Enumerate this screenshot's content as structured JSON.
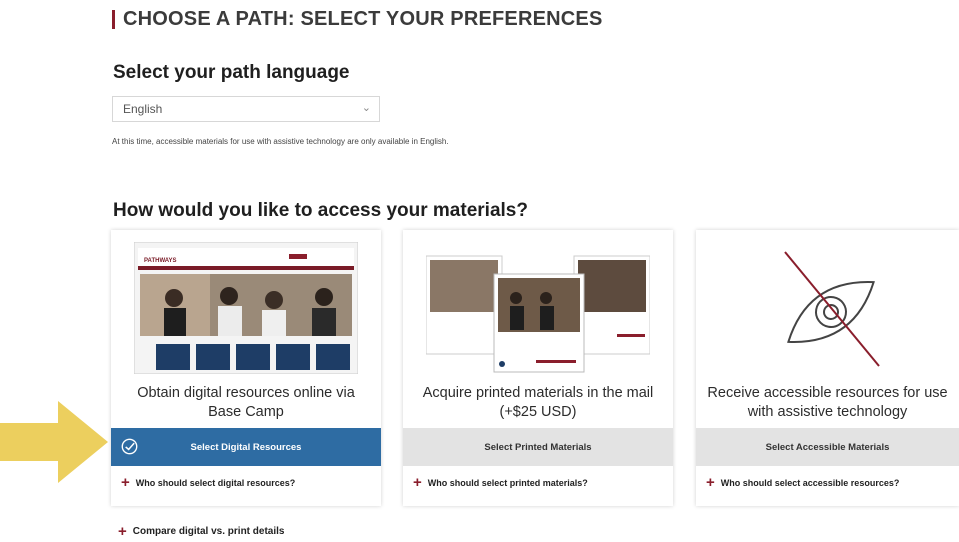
{
  "page_title": "CHOOSE A PATH: SELECT YOUR PREFERENCES",
  "language_section": {
    "heading": "Select your path language",
    "selected_language": "English",
    "note": "At this time, accessible materials for use with assistive technology are only available in English."
  },
  "access_section": {
    "heading": "How would you like to access your materials?",
    "cards": [
      {
        "description": "Obtain digital resources online via Base Camp",
        "button_label": "Select Digital Resources",
        "selected": true,
        "faq_label": "Who should select digital resources?",
        "image_text": "PATHWAYS"
      },
      {
        "description": "Acquire printed materials in the mail (+$25 USD)",
        "button_label": "Select Printed Materials",
        "selected": false,
        "faq_label": "Who should select printed materials?"
      },
      {
        "description": "Receive accessible resources for use with assistive technology",
        "button_label": "Select Accessible Materials",
        "selected": false,
        "faq_label": "Who should select accessible resources?"
      }
    ]
  },
  "compare_link": "Compare digital vs. print details",
  "colors": {
    "accent_maroon": "#8a1e2c",
    "selected_button_blue": "#2e6ca3",
    "unselected_button_gray": "#e3e3e3",
    "arrow_yellow": "#eccf5e"
  },
  "icons": {
    "select_dropdown": "chevron-down-icon",
    "selected_check": "check-circle-icon",
    "accessibility": "eye-slash-icon",
    "expand": "plus-icon",
    "pointer": "arrow-right-icon"
  }
}
